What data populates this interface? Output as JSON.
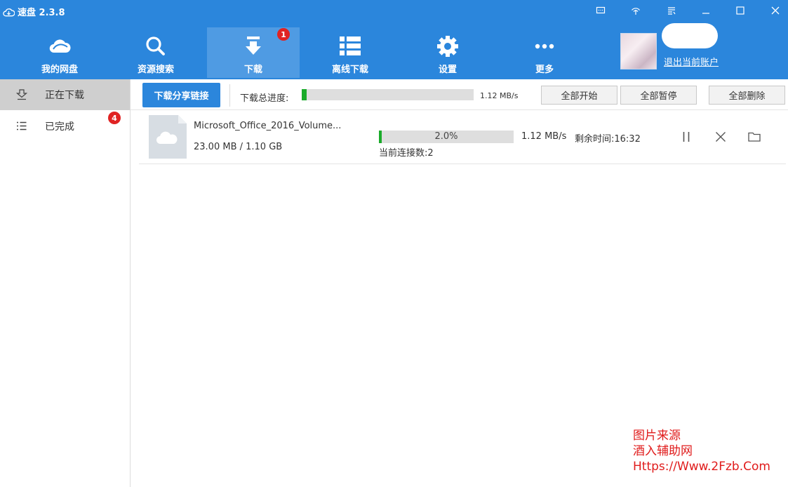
{
  "app": {
    "title": "速盘 2.3.8"
  },
  "window_controls": [
    "screen-icon",
    "wifi-icon",
    "menu-icon",
    "minimize-icon",
    "maximize-icon",
    "close-icon"
  ],
  "nav": {
    "items": [
      {
        "label": "我的网盘",
        "icon": "cloud-icon"
      },
      {
        "label": "资源搜索",
        "icon": "search-icon"
      },
      {
        "label": "下载",
        "icon": "download-icon",
        "badge": "1",
        "active": true
      },
      {
        "label": "离线下载",
        "icon": "list-icon"
      },
      {
        "label": "设置",
        "icon": "gear-icon"
      },
      {
        "label": "更多",
        "icon": "more-icon"
      }
    ]
  },
  "user": {
    "logout_label": "退出当前账户"
  },
  "sidebar": {
    "items": [
      {
        "label": "正在下载",
        "icon": "download-tray-icon",
        "active": true
      },
      {
        "label": "已完成",
        "icon": "list-icon",
        "badge": "4"
      }
    ]
  },
  "toolbar": {
    "share_label": "下载分享链接",
    "total_label": "下载总进度:",
    "total_progress": 0.03,
    "total_speed": "1.12 MB/s",
    "start_all": "全部开始",
    "pause_all": "全部暂停",
    "delete_all": "全部删除"
  },
  "downloads": [
    {
      "name": "Microsoft_Office_2016_Volume...",
      "size": "23.00 MB / 1.10 GB",
      "progress": 0.02,
      "progress_label": "2.0%",
      "speed": "1.12 MB/s",
      "remaining": "剩余时间:16:32",
      "connections": "当前连接数:2"
    }
  ],
  "watermark": {
    "line1": "图片来源",
    "line2": "酒入辅助网",
    "line3": "Https://Www.2Fzb.Com"
  },
  "colors": {
    "brand": "#2b86dc",
    "active_nav": "#4f9be3",
    "progress": "#1aab2a",
    "badge": "#e02323",
    "watermark": "#e01b1b"
  }
}
